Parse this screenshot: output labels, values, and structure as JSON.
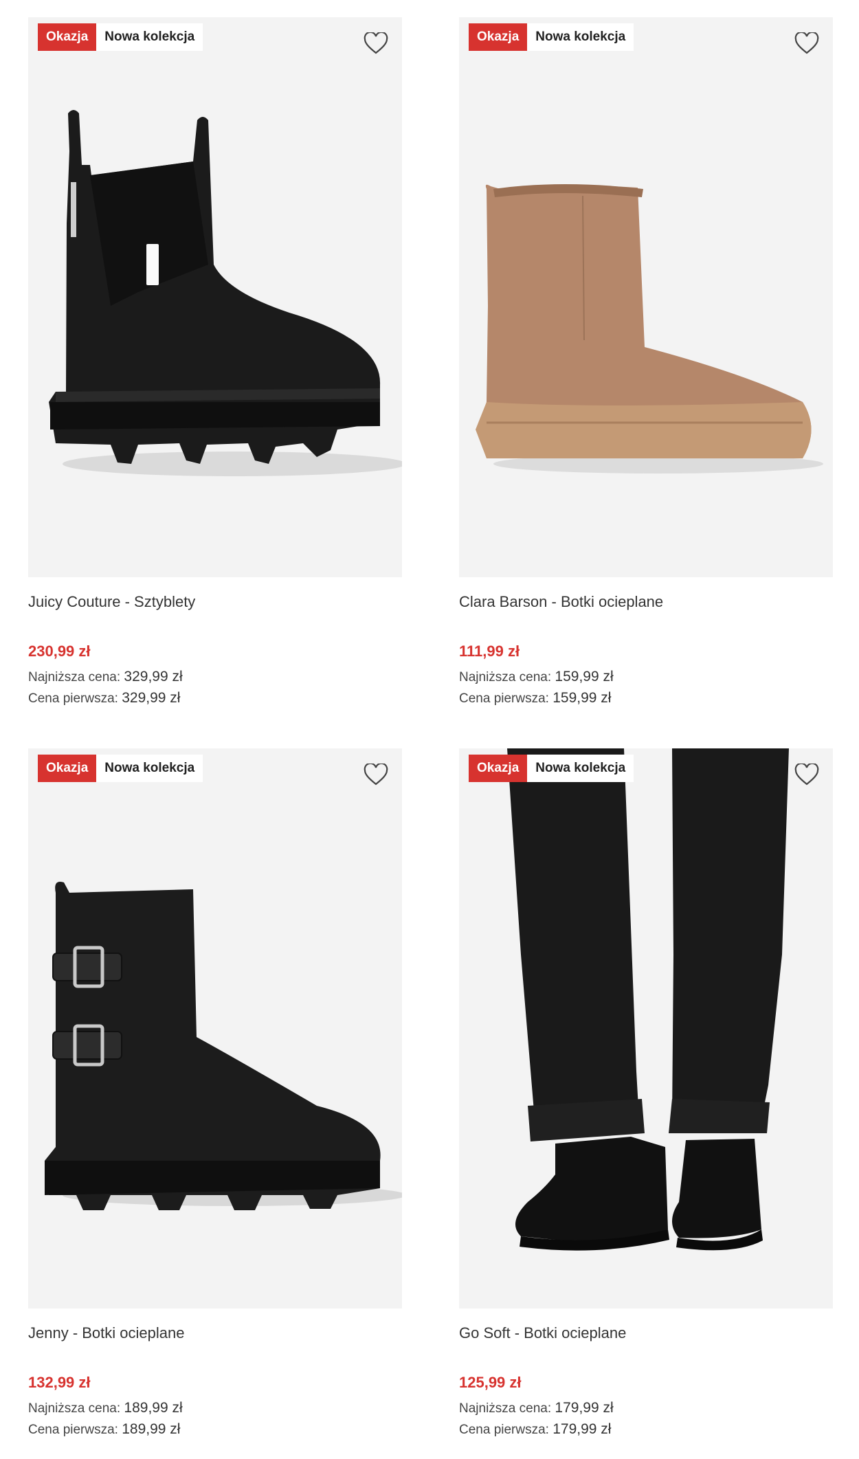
{
  "colors": {
    "accent": "#d7332f",
    "card_bg": "#f3f3f3"
  },
  "products": [
    {
      "badge_sale": "Okazja",
      "badge_new": "Nowa kolekcja",
      "favorite_icon": "heart-outline-icon",
      "title": "Juicy Couture - Sztyblety",
      "price": "230,99 zł",
      "lowest_label": "Najniższa cena:",
      "lowest_value": "329,99 zł",
      "first_label": "Cena pierwsza:",
      "first_value": "329,99 zł"
    },
    {
      "badge_sale": "Okazja",
      "badge_new": "Nowa kolekcja",
      "favorite_icon": "heart-outline-icon",
      "title": "Clara Barson - Botki ocieplane",
      "price": "111,99 zł",
      "lowest_label": "Najniższa cena:",
      "lowest_value": "159,99 zł",
      "first_label": "Cena pierwsza:",
      "first_value": "159,99 zł"
    },
    {
      "badge_sale": "Okazja",
      "badge_new": "Nowa kolekcja",
      "favorite_icon": "heart-outline-icon",
      "title": "Jenny - Botki ocieplane",
      "price": "132,99 zł",
      "lowest_label": "Najniższa cena:",
      "lowest_value": "189,99 zł",
      "first_label": "Cena pierwsza:",
      "first_value": "189,99 zł"
    },
    {
      "badge_sale": "Okazja",
      "badge_new": "Nowa kolekcja",
      "favorite_icon": "heart-outline-icon",
      "title": "Go Soft - Botki ocieplane",
      "price": "125,99 zł",
      "lowest_label": "Najniższa cena:",
      "lowest_value": "179,99 zł",
      "first_label": "Cena pierwsza:",
      "first_value": "179,99 zł"
    }
  ]
}
